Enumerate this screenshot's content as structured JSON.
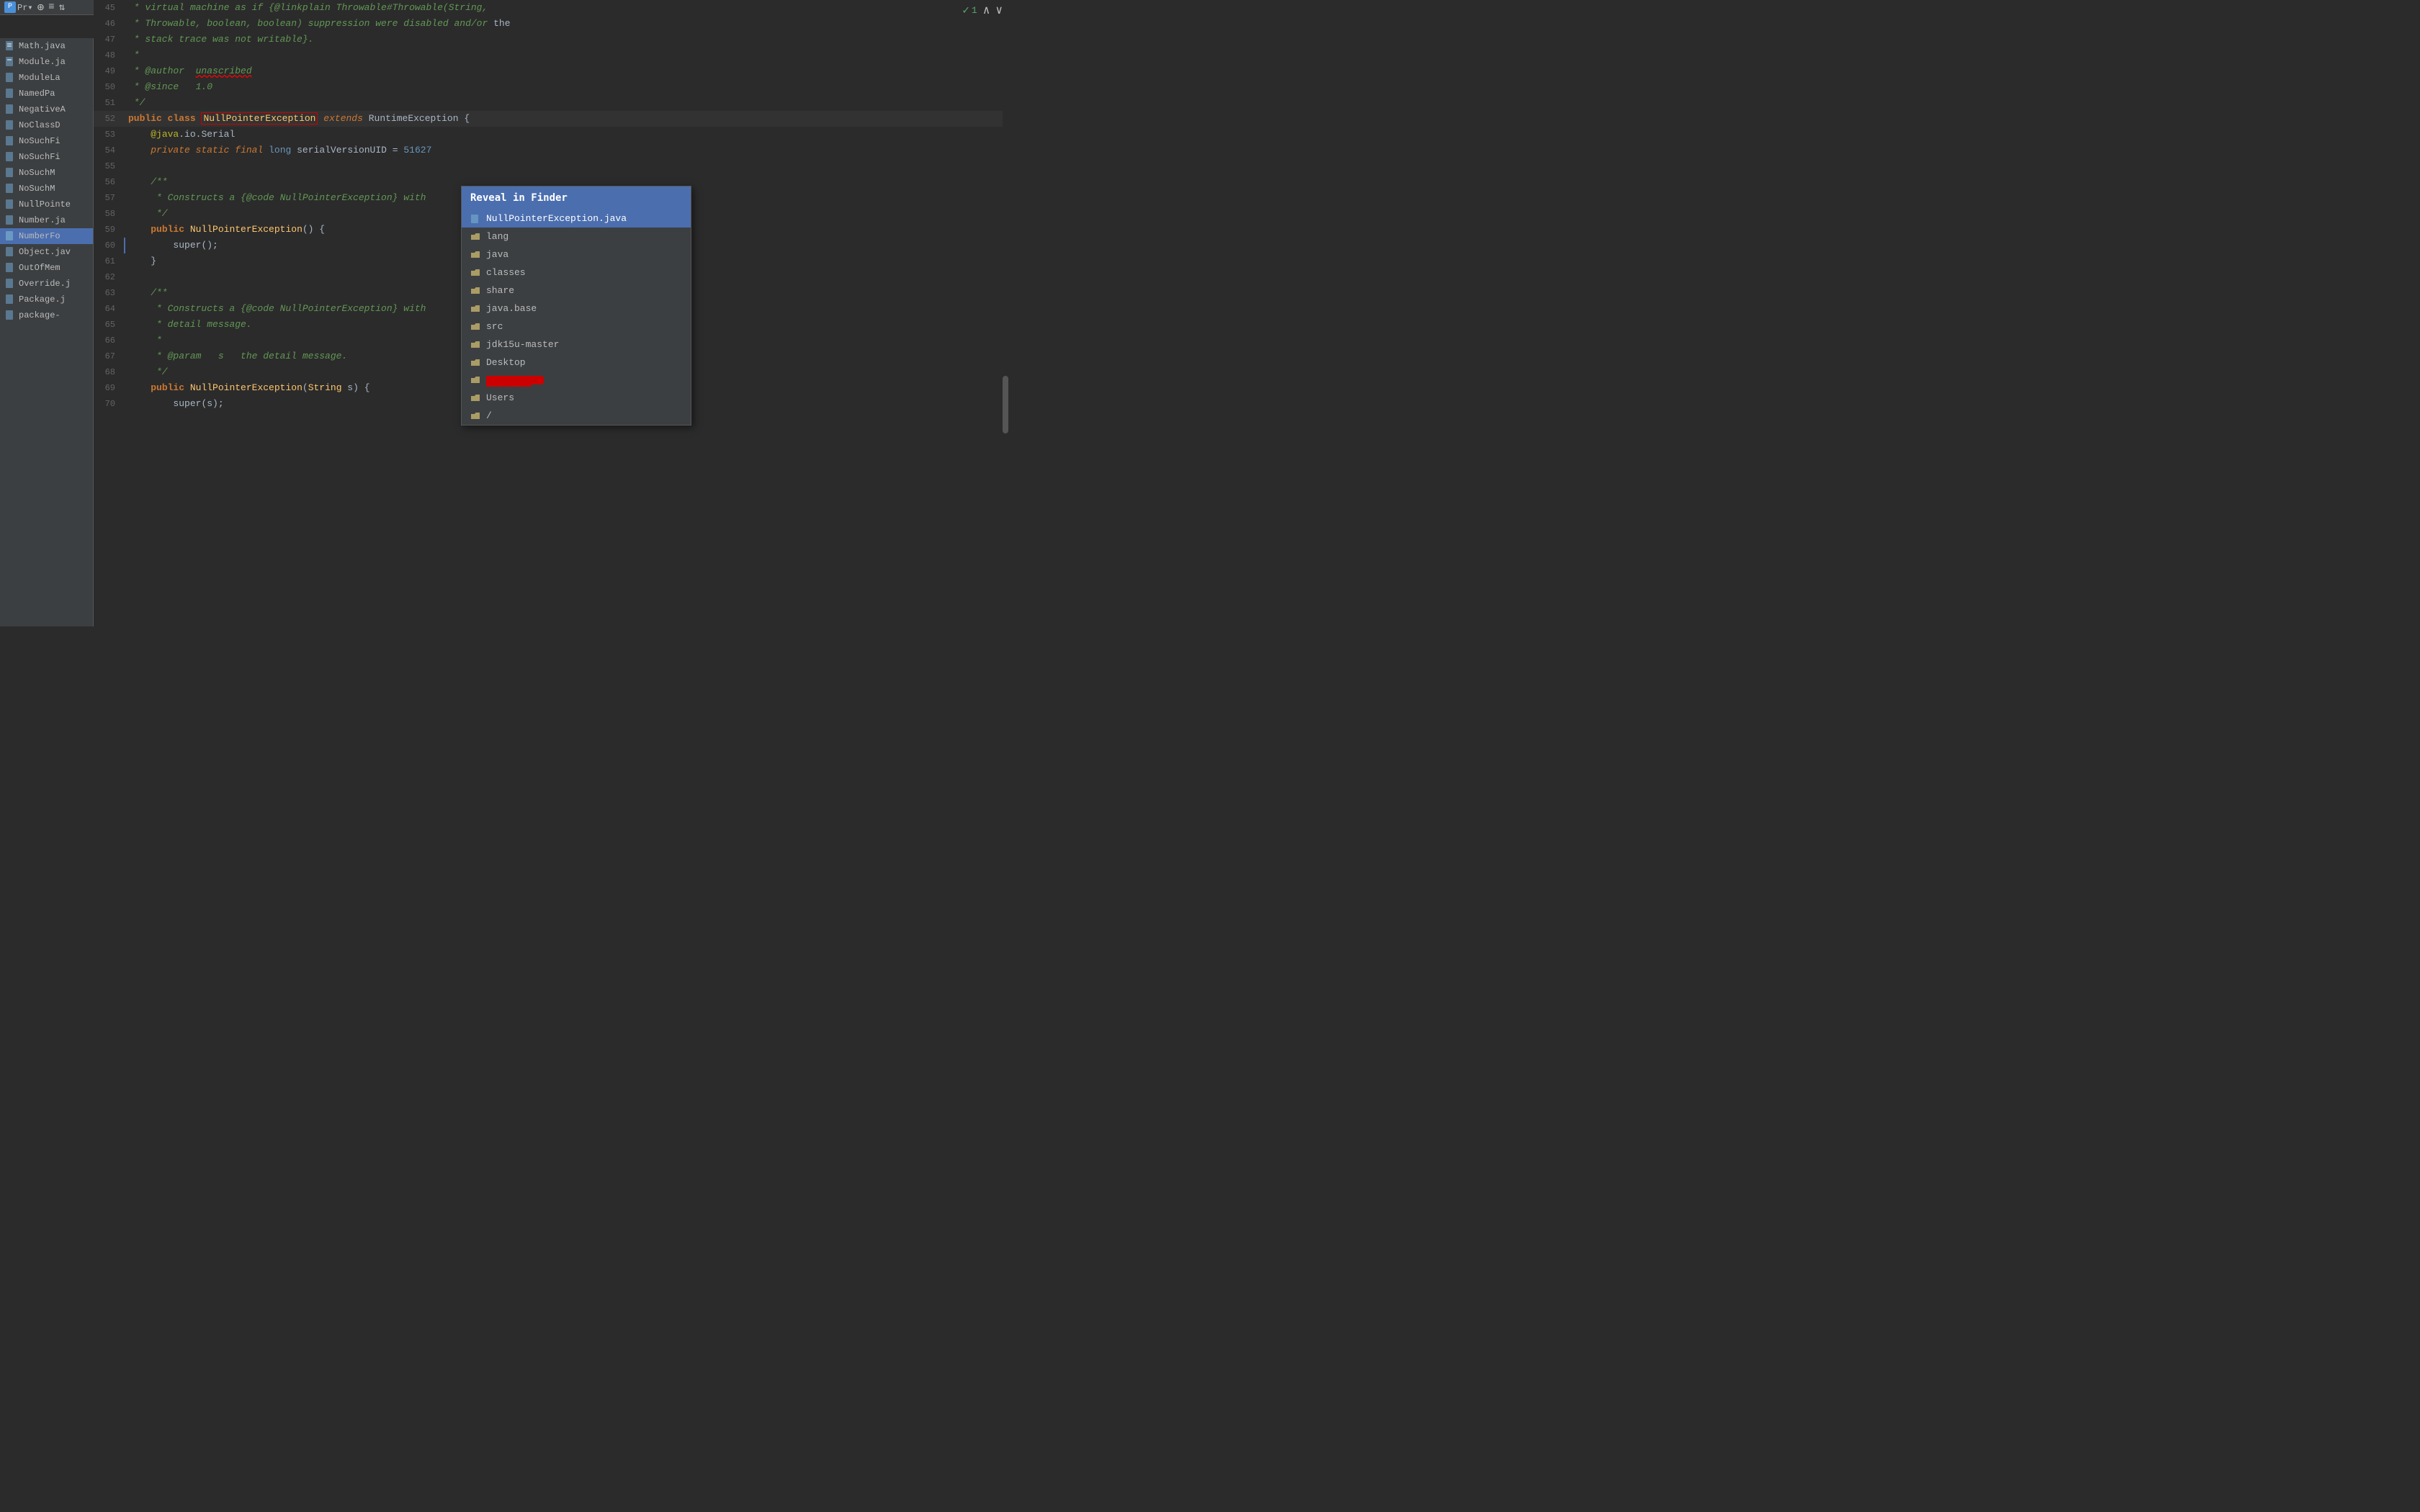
{
  "toolbar": {
    "title": "Pr▾",
    "icons": [
      "cross-circle",
      "center",
      "align-top",
      "search"
    ]
  },
  "sidebar": {
    "items": [
      {
        "label": "Math.java",
        "selected": false
      },
      {
        "label": "Module.ja",
        "selected": false
      },
      {
        "label": "ModuleLa",
        "selected": false
      },
      {
        "label": "NamedPa",
        "selected": false
      },
      {
        "label": "NegativeA",
        "selected": false
      },
      {
        "label": "NoClassD",
        "selected": false
      },
      {
        "label": "NoSuchFi",
        "selected": false
      },
      {
        "label": "NoSuchFi",
        "selected": false
      },
      {
        "label": "NoSuchM",
        "selected": false
      },
      {
        "label": "NoSuchM",
        "selected": false
      },
      {
        "label": "NullPointe",
        "selected": false
      },
      {
        "label": "Number.ja",
        "selected": false
      },
      {
        "label": "NumberFo",
        "selected": true
      },
      {
        "label": "Object.jav",
        "selected": false
      },
      {
        "label": "OutOfMem",
        "selected": false
      },
      {
        "label": "Override.j",
        "selected": false
      },
      {
        "label": "Package.j",
        "selected": false
      },
      {
        "label": "package-",
        "selected": false
      }
    ]
  },
  "code": {
    "lines": [
      {
        "num": 45,
        "content": " * virtual machine as if {@linkplain Throwable#Throwable(String,",
        "type": "comment"
      },
      {
        "num": 46,
        "content": " * Throwable, boolean, boolean) suppression were disabled and/or the",
        "type": "comment"
      },
      {
        "num": 47,
        "content": " * stack trace was not writable}.",
        "type": "comment"
      },
      {
        "num": 48,
        "content": " *",
        "type": "comment"
      },
      {
        "num": 49,
        "content": " * @author  unascribed",
        "type": "comment-author"
      },
      {
        "num": 50,
        "content": " * @since   1.0",
        "type": "comment-since"
      },
      {
        "num": 51,
        "content": " */",
        "type": "comment"
      },
      {
        "num": 52,
        "content": "public class NullPointerException extends RuntimeException {",
        "type": "class-decl"
      },
      {
        "num": 53,
        "content": "    @java.io.Serial",
        "type": "annotation-line"
      },
      {
        "num": 54,
        "content": "    private static final long serialVersionUID = 51627",
        "type": "field-decl"
      },
      {
        "num": 55,
        "content": "",
        "type": "empty"
      },
      {
        "num": 56,
        "content": "    /**",
        "type": "comment"
      },
      {
        "num": 57,
        "content": "     * Constructs a {@code NullPointerException} with",
        "type": "comment"
      },
      {
        "num": 58,
        "content": "     */",
        "type": "comment"
      },
      {
        "num": 59,
        "content": "    public NullPointerException() {",
        "type": "method-decl"
      },
      {
        "num": 60,
        "content": "        super();",
        "type": "method-body"
      },
      {
        "num": 61,
        "content": "    }",
        "type": "brace"
      },
      {
        "num": 62,
        "content": "",
        "type": "empty"
      },
      {
        "num": 63,
        "content": "    /**",
        "type": "comment"
      },
      {
        "num": 64,
        "content": "     * Constructs a {@code NullPointerException} with",
        "type": "comment"
      },
      {
        "num": 65,
        "content": "     * detail message.",
        "type": "comment"
      },
      {
        "num": 66,
        "content": "     *",
        "type": "comment"
      },
      {
        "num": 67,
        "content": "     * @param   s   the detail message.",
        "type": "comment-param"
      },
      {
        "num": 68,
        "content": "     */",
        "type": "comment"
      },
      {
        "num": 69,
        "content": "    public NullPointerException(String s) {",
        "type": "method-decl"
      },
      {
        "num": 70,
        "content": "        super(s);",
        "type": "method-body"
      }
    ]
  },
  "popup": {
    "header": "Reveal in Finder",
    "items": [
      {
        "label": "NullPointerException.java",
        "type": "file",
        "selected": true
      },
      {
        "label": "lang",
        "type": "folder"
      },
      {
        "label": "java",
        "type": "folder"
      },
      {
        "label": "classes",
        "type": "folder"
      },
      {
        "label": "share",
        "type": "folder"
      },
      {
        "label": "java.base",
        "type": "folder"
      },
      {
        "label": "src",
        "type": "folder"
      },
      {
        "label": "jdk15u-master",
        "type": "folder"
      },
      {
        "label": "Desktop",
        "type": "folder"
      },
      {
        "label": "[redacted]",
        "type": "folder-redacted"
      },
      {
        "label": "Users",
        "type": "folder"
      },
      {
        "label": "/",
        "type": "folder"
      }
    ]
  },
  "topright": {
    "check_count": "1",
    "check_label": "✓"
  }
}
